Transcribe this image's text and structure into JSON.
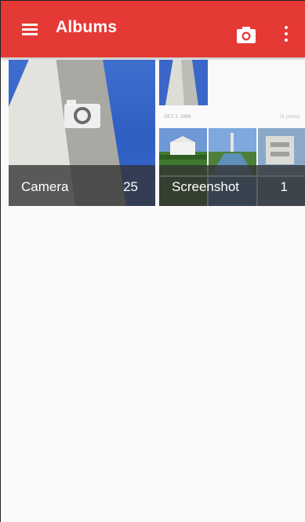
{
  "toolbar": {
    "title": "Albums",
    "background_color": "#e53935",
    "menu_icon": "hamburger-menu-icon",
    "camera_icon": "camera-icon",
    "overflow_icon": "more-vert-icon"
  },
  "albums": [
    {
      "name": "Camera",
      "count": "25"
    },
    {
      "name": "Screenshot",
      "count": "1"
    }
  ],
  "screenshot_preview": {
    "date": "OCT 7, 2008",
    "photos_label": "21 photos"
  }
}
